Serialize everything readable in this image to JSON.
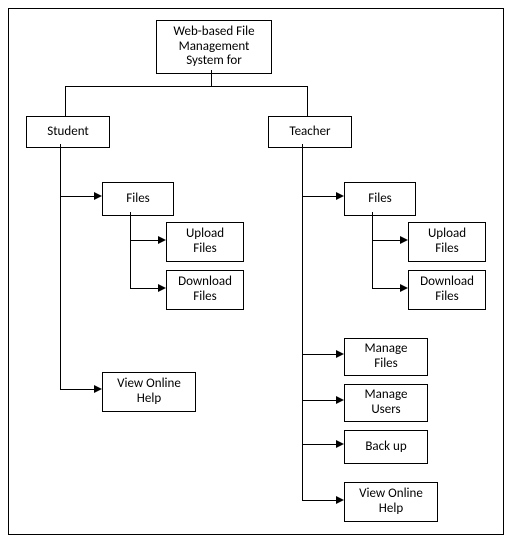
{
  "root": {
    "title": "Web-based File\nManagement\nSystem for"
  },
  "student": {
    "label": "Student",
    "files": "Files",
    "upload": "Upload\nFiles",
    "download": "Download\nFiles",
    "help": "View Online\nHelp"
  },
  "teacher": {
    "label": "Teacher",
    "files": "Files",
    "upload": "Upload\nFiles",
    "download": "Download\nFiles",
    "manage_files": "Manage\nFiles",
    "manage_users": "Manage\nUsers",
    "backup": "Back up",
    "help": "View Online\nHelp"
  }
}
